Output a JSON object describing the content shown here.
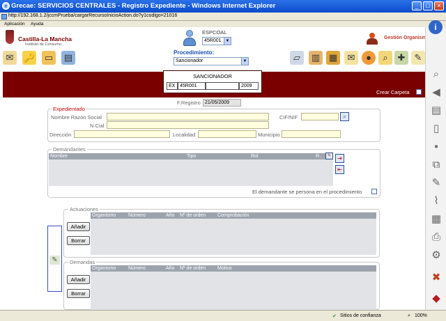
{
  "window": {
    "title": "Grecae: SERVICIOS CENTRALES - Registro Expediente - Windows Internet Explorer",
    "url": "http://192.168.1.2/jccmPrueba/cargarRecursoInicioAction.do?y1codigo=21016"
  },
  "menu": [
    "Aplicación",
    "Ayuda"
  ],
  "header": {
    "logo_title": "Castilla-La Mancha",
    "logo_subtitle": "Instituto de Consumo",
    "user_label": "ESPCOAL",
    "user_select_value": "45R001",
    "gestion_label": "Gestión Organismo",
    "procedimiento_label": "Procedimiento:",
    "procedimiento_value": "Sancionador"
  },
  "expediente_box": {
    "title": "SANCIONADOR",
    "cells": [
      "EX",
      "45R001",
      "",
      "2009"
    ]
  },
  "crear_carpeta_label": "Crear Carpeta",
  "registro": {
    "label": "F.Registro",
    "value": "21/05/2009"
  },
  "expedientado": {
    "legend": "Expedientado",
    "nombre_label": "Nombre Razón Social",
    "cif_label": "CIF/NIF",
    "ncial_label": "N Cial",
    "direccion_label": "Dirección",
    "localidad_label": "Localidad",
    "municipio_label": "Municipio"
  },
  "demandantes": {
    "legend": "Demandantes",
    "columns": [
      "Nombre",
      "Tipo",
      "Rol",
      "R.."
    ],
    "persona_label": "El demandante se persona en el procedimiento"
  },
  "actuaciones": {
    "legend": "Actuaciones",
    "columns": [
      "Organismo",
      "Número",
      "Año",
      "Nº de orden",
      "Comprobación"
    ],
    "add_label": "Añadir",
    "delete_label": "Borrar"
  },
  "demandas": {
    "legend": "Demandas",
    "columns": [
      "Organismo",
      "Número",
      "Año",
      "Nº de orden",
      "Motivo"
    ],
    "add_label": "Añadir",
    "delete_label": "Borrar"
  },
  "statusbar": {
    "zone": "Sitios de confianza",
    "zoom": "100%"
  },
  "colors": {
    "banner": "#7a0000",
    "title_bar": "#0a4bc9",
    "legend_red": "#cc0000",
    "table_header": "#9ca3ad"
  }
}
